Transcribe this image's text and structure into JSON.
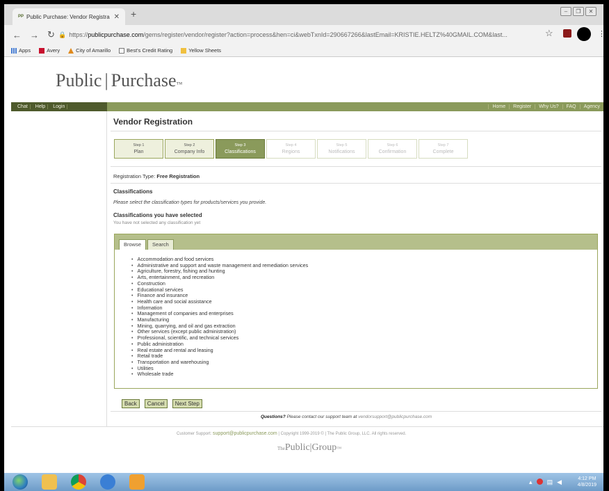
{
  "browser": {
    "tab_title": "Public Purchase: Vendor Registra",
    "tab_favicon": "PP",
    "new_tab": "+",
    "url_host": "publicpurchase.com",
    "url_prefix": "https://",
    "url_path": "/gems/register/vendor/register?action=process&hen=ci&webTxnId=290667266&lastEmail=KRISTIE.HELTZ%40GMAIL.COM&last...",
    "bookmarks": [
      {
        "label": "Apps",
        "icon": "apps-icon"
      },
      {
        "label": "Avery",
        "icon": "avery-icon"
      },
      {
        "label": "City of Amarillo",
        "icon": "city-icon"
      },
      {
        "label": "Best's Credit Rating",
        "icon": "doc-icon"
      },
      {
        "label": "Yellow Sheets",
        "icon": "folder-icon"
      }
    ]
  },
  "site": {
    "logo_left": "Public",
    "logo_right": "Purchase",
    "logo_tm": "™",
    "nav_left": [
      "Chat",
      "Help",
      "Login"
    ],
    "nav_right": [
      "Home",
      "Register",
      "Why Us?",
      "FAQ",
      "Agency"
    ]
  },
  "main": {
    "title": "Vendor Registration",
    "steps": [
      {
        "num": "Step 1",
        "label": "Plan"
      },
      {
        "num": "Step 2",
        "label": "Company Info"
      },
      {
        "num": "Step 3",
        "label": "Classifications"
      },
      {
        "num": "Step 4",
        "label": "Regions"
      },
      {
        "num": "Step 5",
        "label": "Notifications"
      },
      {
        "num": "Step 6",
        "label": "Confirmation"
      },
      {
        "num": "Step 7",
        "label": "Complete"
      }
    ],
    "reg_type_label": "Registration Type:",
    "reg_type_value": "Free Registration",
    "classifications_title": "Classifications",
    "classifications_desc": "Please select the classification types for products/services you provide.",
    "selected_title": "Classifications you have selected",
    "selected_empty": "You have not selected any classification yet",
    "tabs": [
      "Browse",
      "Search"
    ],
    "categories": [
      "Accommodation and food services",
      "Administrative and support and waste management and remediation services",
      "Agriculture, forestry, fishing and hunting",
      "Arts, entertainment, and recreation",
      "Construction",
      "Educational services",
      "Finance and insurance",
      "Health care and social assistance",
      "Information",
      "Management of companies and enterprises",
      "Manufacturing",
      "Mining, quarrying, and oil and gas extraction",
      "Other services (except public administration)",
      "Professional, scientific, and technical services",
      "Public administration",
      "Real estate and rental and leasing",
      "Retail trade",
      "Transportation and warehousing",
      "Utilities",
      "Wholesale trade"
    ],
    "buttons": {
      "back": "Back",
      "cancel": "Cancel",
      "next": "Next Step"
    },
    "questions_bold": "Questions?",
    "questions_text": "Please contact our support team at",
    "questions_email": "vendorsupport@publicpurchase.com"
  },
  "footer": {
    "support_label": "Customer Support:",
    "support_email": "support@publicpurchase.com",
    "copyright": "| Copyright 1999-2019 © | The Public Group, LLC. All rights reserved.",
    "group_prefix": "The",
    "group_left": "Public",
    "group_right": "Group",
    "group_tm": "™"
  },
  "taskbar": {
    "time": "4:12 PM",
    "date": "4/8/2019"
  }
}
